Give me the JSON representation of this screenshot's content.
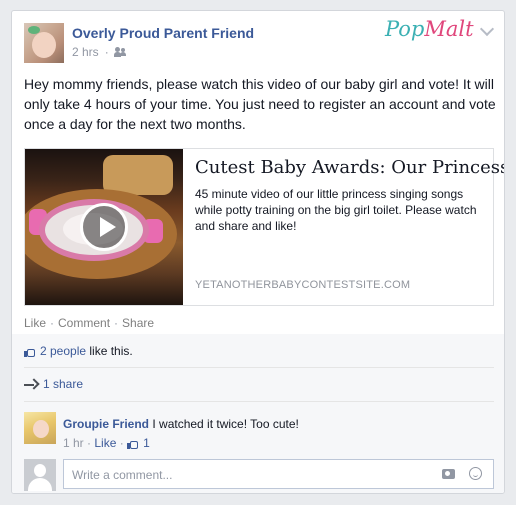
{
  "post": {
    "author": "Overly Proud Parent Friend",
    "time": "2 hrs",
    "privacy_icon": "friends-icon",
    "text": "Hey mommy friends, please watch this video of our baby girl and vote! It will only take 4 hours of your time. You just need to register an account and vote once a day for the next two months."
  },
  "brand": {
    "part1": "Pop",
    "part2": "Malt",
    "color1": "#3bb0b3",
    "color2": "#e0477c"
  },
  "link": {
    "title": "Cutest Baby Awards: Our Princess",
    "description": "45 minute video of our little princess singing songs while potty training on the big girl toilet. Please watch and share and like!",
    "domain": "YETANOTHERBABYCONTESTSITE.COM"
  },
  "actions": {
    "like": "Like",
    "sep": "·",
    "comment": "Comment",
    "share": "Share"
  },
  "ufi": {
    "likes_link": "2 people",
    "likes_suffix": " like this.",
    "shares": "1 share"
  },
  "comment": {
    "author": "Groupie Friend",
    "text": "I watched it twice! Too cute!",
    "time": "1 hr",
    "like_label": "Like",
    "like_count": "1"
  },
  "composer": {
    "placeholder": "Write a comment..."
  },
  "colors": {
    "link_blue": "#3b5998",
    "background": "#e9ebee"
  }
}
